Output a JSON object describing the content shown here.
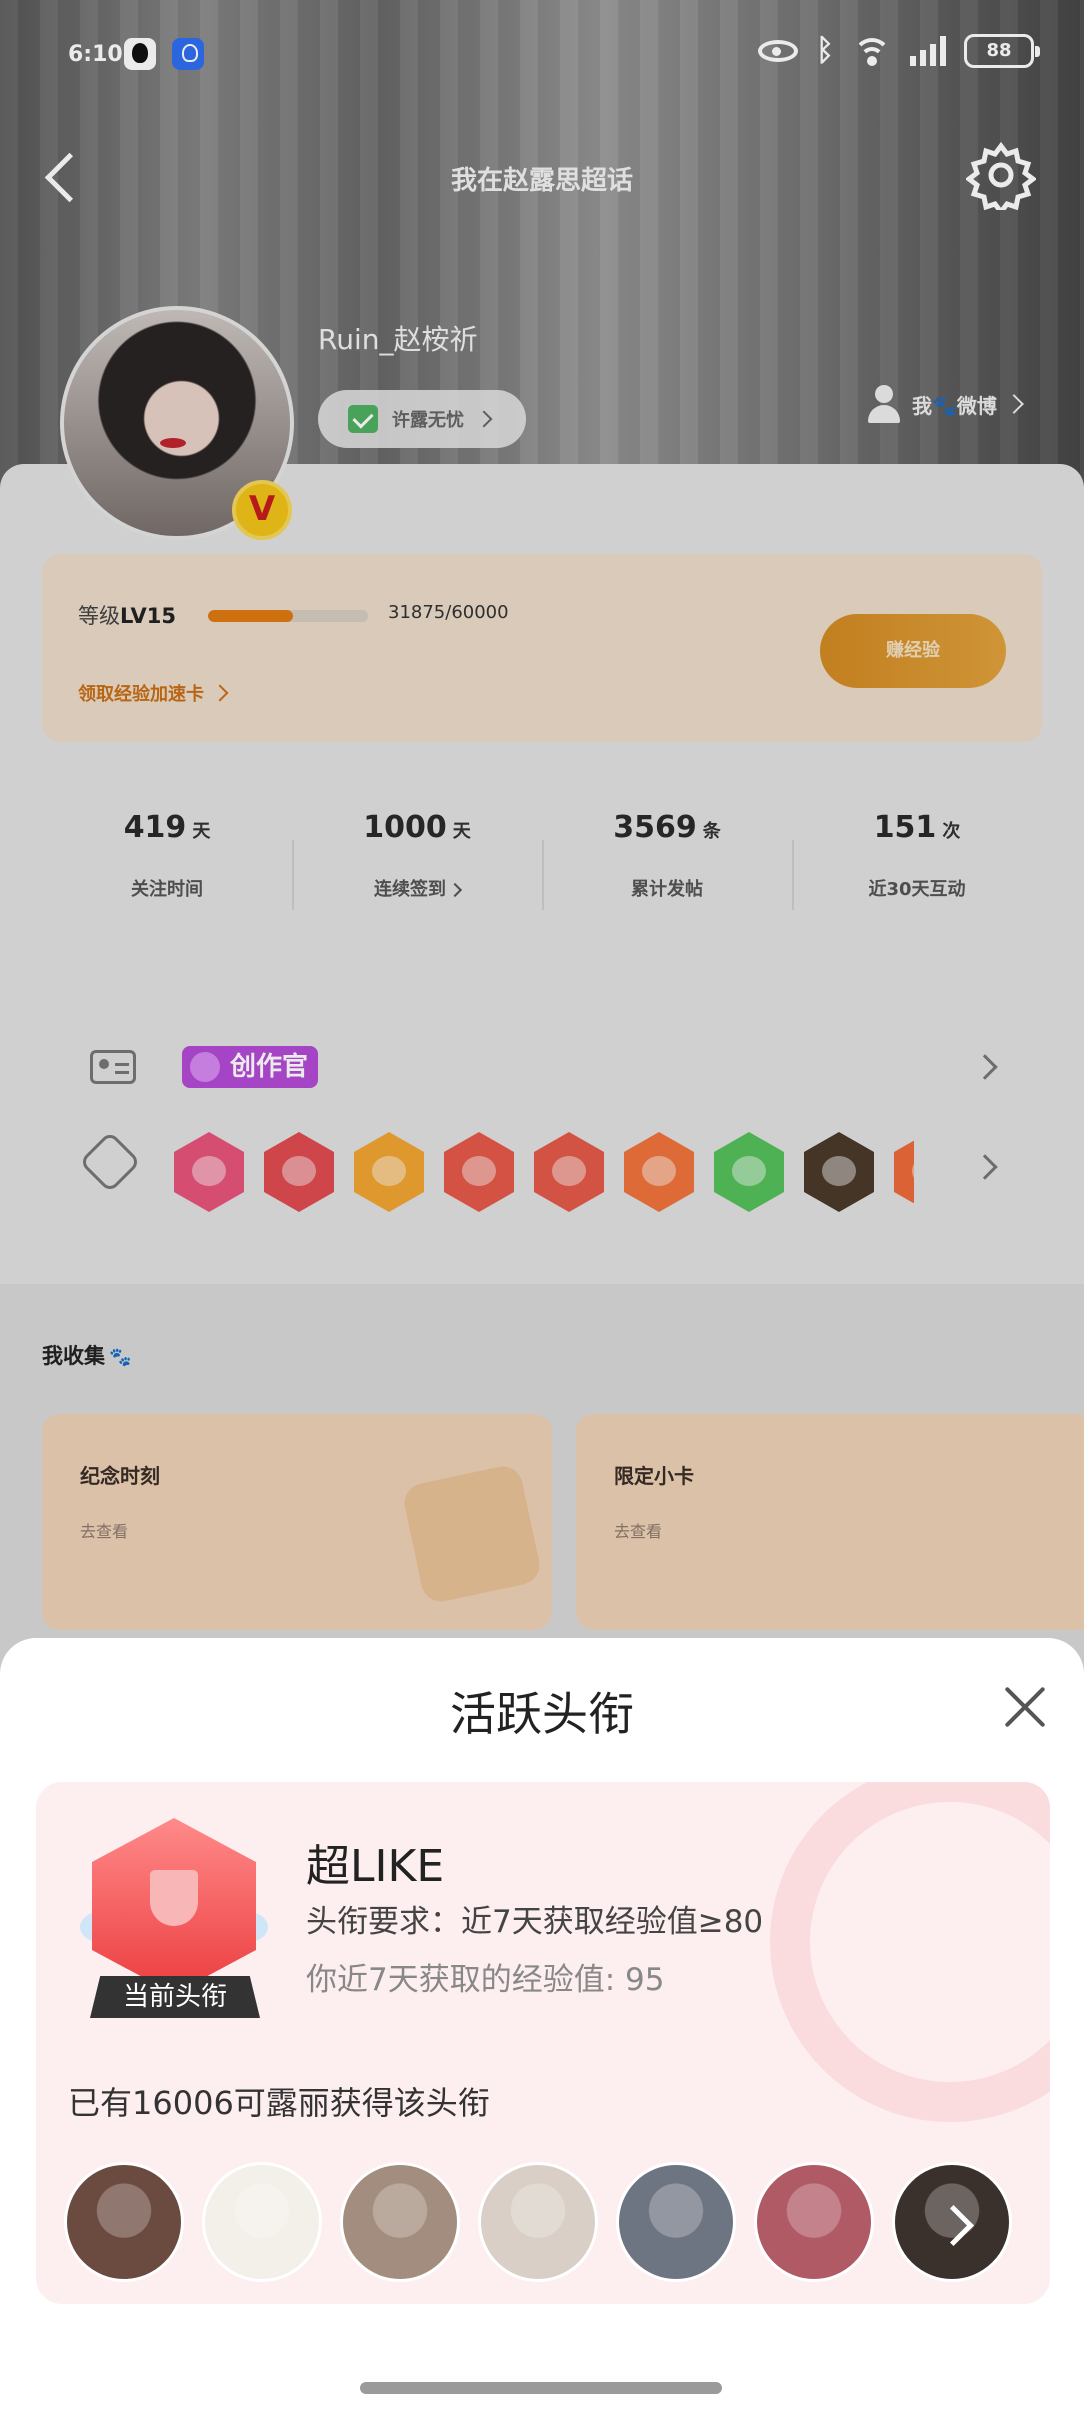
{
  "status_bar": {
    "time": "6:10",
    "battery": "88",
    "icons": [
      "qq-icon",
      "bulb-icon",
      "eye-icon",
      "bluetooth-icon",
      "wifi-icon",
      "signal-icon",
      "battery-icon"
    ]
  },
  "nav": {
    "title": "我在赵露思超话",
    "back_icon": "back-arrow",
    "settings_icon": "gear"
  },
  "profile": {
    "username": "Ruin_赵桉祈",
    "title_chip": "许露无忧",
    "my_weibo": "我🐾微博",
    "vip_mark": "V"
  },
  "level": {
    "label_prefix": "等级",
    "level": "LV15",
    "progress_text": "31875/60000",
    "progress": 0.53,
    "link": "领取经验加速卡",
    "earn_button": "赚经验"
  },
  "stats": [
    {
      "value": "419",
      "unit": "天",
      "label": "关注时间"
    },
    {
      "value": "1000",
      "unit": "天",
      "label": "连续签到"
    },
    {
      "value": "3569",
      "unit": "条",
      "label": "累计发帖"
    },
    {
      "value": "151",
      "unit": "次",
      "label": "近30天互动"
    }
  ],
  "badges": {
    "creator_tag": "创作官",
    "badge_colors": [
      "#e8547a",
      "#e04b51",
      "#f2a531",
      "#e5594a",
      "#e45a4a",
      "#f0743c",
      "#55c25d",
      "#4a3a2a",
      "#ee6b3a"
    ]
  },
  "collection": {
    "title": "我收集",
    "cards": [
      {
        "title": "纪念时刻",
        "sub": "去查看"
      },
      {
        "title": "限定小卡",
        "sub": "去查看"
      }
    ]
  },
  "sheet": {
    "title": "活跃头衔",
    "badge_name": "超LIKE",
    "current_tag": "当前头衔",
    "requirement": "头衔要求：近7天获取经验值≥80",
    "earned": "你近7天获取的经验值: 95",
    "owners_text": "已有16006可露丽获得该头衔",
    "owner_avatar_colors": [
      "#6b4a40",
      "#f3efe9",
      "#a38d7e",
      "#d9cfc6",
      "#6d7482",
      "#b05a66",
      "#3a302c"
    ]
  },
  "colors": {
    "accent_orange": "#e07a12",
    "badge_red": "#ec3d3f",
    "sheet_card_bg": "#fdeff0"
  }
}
